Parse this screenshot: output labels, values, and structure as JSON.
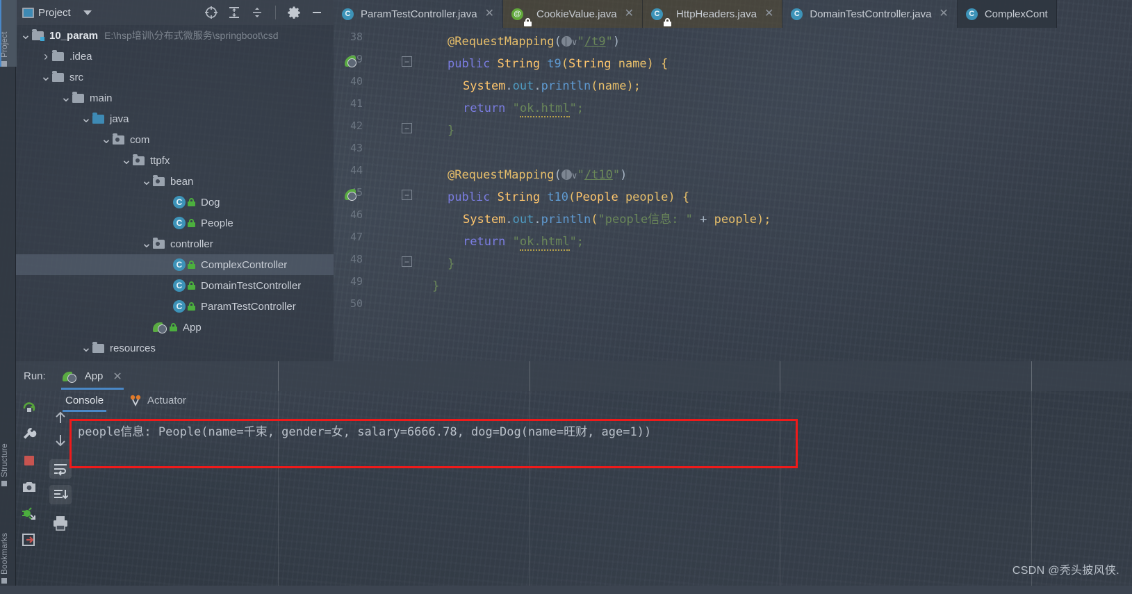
{
  "left_strip": {
    "items": [
      {
        "label": "Project",
        "icon": "project-icon",
        "selected": true
      },
      {
        "label": "Structure",
        "icon": "structure-icon",
        "selected": false
      },
      {
        "label": "Bookmarks",
        "icon": "bookmarks-icon",
        "selected": false
      }
    ]
  },
  "project_panel": {
    "title": "Project",
    "icon": "project-window-icon",
    "dropdown_icon": "chevron-down-icon",
    "toolbar": [
      {
        "name": "locate-icon",
        "tooltip": "Select Opened File"
      },
      {
        "name": "expand-all-icon",
        "tooltip": "Expand All"
      },
      {
        "name": "collapse-all-icon",
        "tooltip": "Collapse All"
      },
      {
        "name": "gear-icon",
        "tooltip": "Settings"
      },
      {
        "name": "minimize-icon",
        "tooltip": "Hide"
      }
    ],
    "tree": [
      {
        "label": "10_param",
        "path": "E:\\hsp培训\\分布式微服务\\springboot\\csd",
        "indent": 0,
        "arrow": "expanded",
        "icon": "module-folder",
        "bold": true,
        "selected": false
      },
      {
        "label": ".idea",
        "path": "",
        "indent": 1,
        "arrow": "collapsed",
        "icon": "folder",
        "bold": false,
        "selected": false
      },
      {
        "label": "src",
        "path": "",
        "indent": 1,
        "arrow": "expanded",
        "icon": "folder",
        "bold": false,
        "selected": false
      },
      {
        "label": "main",
        "path": "",
        "indent": 2,
        "arrow": "expanded",
        "icon": "folder",
        "bold": false,
        "selected": false
      },
      {
        "label": "java",
        "path": "",
        "indent": 3,
        "arrow": "expanded",
        "icon": "source-folder",
        "bold": false,
        "selected": false
      },
      {
        "label": "com",
        "path": "",
        "indent": 4,
        "arrow": "expanded",
        "icon": "package",
        "bold": false,
        "selected": false
      },
      {
        "label": "ttpfx",
        "path": "",
        "indent": 5,
        "arrow": "expanded",
        "icon": "package",
        "bold": false,
        "selected": false
      },
      {
        "label": "bean",
        "path": "",
        "indent": 6,
        "arrow": "expanded",
        "icon": "package",
        "bold": false,
        "selected": false
      },
      {
        "label": "Dog",
        "path": "",
        "indent": 7,
        "arrow": "none",
        "icon": "java-class",
        "bold": false,
        "selected": false
      },
      {
        "label": "People",
        "path": "",
        "indent": 7,
        "arrow": "none",
        "icon": "java-class",
        "bold": false,
        "selected": false
      },
      {
        "label": "controller",
        "path": "",
        "indent": 6,
        "arrow": "expanded",
        "icon": "package",
        "bold": false,
        "selected": false
      },
      {
        "label": "ComplexController",
        "path": "",
        "indent": 7,
        "arrow": "none",
        "icon": "java-class",
        "bold": false,
        "selected": true
      },
      {
        "label": "DomainTestController",
        "path": "",
        "indent": 7,
        "arrow": "none",
        "icon": "java-class",
        "bold": false,
        "selected": false
      },
      {
        "label": "ParamTestController",
        "path": "",
        "indent": 7,
        "arrow": "none",
        "icon": "java-class",
        "bold": false,
        "selected": false
      },
      {
        "label": "App",
        "path": "",
        "indent": 6,
        "arrow": "none",
        "icon": "spring-runnable-class",
        "bold": false,
        "selected": false
      },
      {
        "label": "resources",
        "path": "",
        "indent": 3,
        "arrow": "expanded",
        "icon": "folder",
        "bold": false,
        "selected": false
      }
    ]
  },
  "editor_tabs": [
    {
      "label": "ParamTestController.java",
      "icon": "java-class",
      "active": false,
      "closable": true,
      "style": "normal"
    },
    {
      "label": "CookieValue.java",
      "icon": "java-annotation",
      "active": false,
      "closable": true,
      "style": "library"
    },
    {
      "label": "HttpHeaders.java",
      "icon": "java-class",
      "active": false,
      "closable": true,
      "style": "library"
    },
    {
      "label": "DomainTestController.java",
      "icon": "java-class",
      "active": false,
      "closable": true,
      "style": "normal"
    },
    {
      "label": "ComplexCont",
      "icon": "java-class",
      "active": true,
      "closable": false,
      "style": "normal"
    }
  ],
  "editor": {
    "first_line": 38,
    "lines": [
      {
        "num": 38,
        "indent": 2,
        "gutter": "",
        "fold": "",
        "tokens": [
          {
            "t": "@RequestMapping",
            "c": "y"
          },
          {
            "t": "(",
            "c": "t"
          },
          {
            "t": "GLOBE",
            "c": "icon"
          },
          {
            "t": "\"",
            "c": "s"
          },
          {
            "t": "/t9",
            "c": "s u"
          },
          {
            "t": "\"",
            "c": "s"
          },
          {
            "t": ")",
            "c": "t"
          }
        ]
      },
      {
        "num": 39,
        "indent": 2,
        "gutter": "spring-bean",
        "fold": "minus",
        "tokens": [
          {
            "t": "public ",
            "c": "kw"
          },
          {
            "t": "String ",
            "c": "m"
          },
          {
            "t": "t9",
            "c": "bl"
          },
          {
            "t": "(",
            "c": "y"
          },
          {
            "t": "String ",
            "c": "m"
          },
          {
            "t": "name",
            "c": "y"
          },
          {
            "t": ") {",
            "c": "y"
          }
        ]
      },
      {
        "num": 40,
        "indent": 3,
        "gutter": "",
        "fold": "",
        "tokens": [
          {
            "t": "System",
            "c": "m"
          },
          {
            "t": ".",
            "c": "t"
          },
          {
            "t": "out",
            "c": "cy"
          },
          {
            "t": ".",
            "c": "t"
          },
          {
            "t": "println",
            "c": "bl"
          },
          {
            "t": "(",
            "c": "y"
          },
          {
            "t": "name",
            "c": "y"
          },
          {
            "t": ");",
            "c": "y"
          }
        ]
      },
      {
        "num": 41,
        "indent": 3,
        "gutter": "",
        "fold": "",
        "tokens": [
          {
            "t": "return ",
            "c": "kw"
          },
          {
            "t": "\"",
            "c": "s"
          },
          {
            "t": "ok.html",
            "c": "s wavy"
          },
          {
            "t": "\";",
            "c": "s"
          }
        ]
      },
      {
        "num": 42,
        "indent": 2,
        "gutter": "",
        "fold": "minus",
        "tokens": [
          {
            "t": "}",
            "c": "s"
          }
        ]
      },
      {
        "num": 43,
        "indent": 0,
        "gutter": "",
        "fold": "",
        "tokens": []
      },
      {
        "num": 44,
        "indent": 2,
        "gutter": "",
        "fold": "",
        "tokens": [
          {
            "t": "@RequestMapping",
            "c": "y"
          },
          {
            "t": "(",
            "c": "t"
          },
          {
            "t": "GLOBE",
            "c": "icon"
          },
          {
            "t": "\"",
            "c": "s"
          },
          {
            "t": "/t10",
            "c": "s u"
          },
          {
            "t": "\"",
            "c": "s"
          },
          {
            "t": ")",
            "c": "t"
          }
        ]
      },
      {
        "num": 45,
        "indent": 2,
        "gutter": "spring-bean",
        "fold": "minus",
        "tokens": [
          {
            "t": "public ",
            "c": "kw"
          },
          {
            "t": "String ",
            "c": "m"
          },
          {
            "t": "t10",
            "c": "bl"
          },
          {
            "t": "(",
            "c": "y"
          },
          {
            "t": "People ",
            "c": "m"
          },
          {
            "t": "people",
            "c": "y"
          },
          {
            "t": ") {",
            "c": "y"
          }
        ]
      },
      {
        "num": 46,
        "indent": 3,
        "gutter": "",
        "fold": "",
        "tokens": [
          {
            "t": "System",
            "c": "m"
          },
          {
            "t": ".",
            "c": "t"
          },
          {
            "t": "out",
            "c": "cy"
          },
          {
            "t": ".",
            "c": "t"
          },
          {
            "t": "println",
            "c": "bl"
          },
          {
            "t": "(",
            "c": "y"
          },
          {
            "t": "\"people信息: \"",
            "c": "s"
          },
          {
            "t": " + ",
            "c": "t"
          },
          {
            "t": "people",
            "c": "y"
          },
          {
            "t": ");",
            "c": "y"
          }
        ]
      },
      {
        "num": 47,
        "indent": 3,
        "gutter": "",
        "fold": "",
        "tokens": [
          {
            "t": "return ",
            "c": "kw"
          },
          {
            "t": "\"",
            "c": "s"
          },
          {
            "t": "ok.html",
            "c": "s wavy"
          },
          {
            "t": "\";",
            "c": "s"
          }
        ]
      },
      {
        "num": 48,
        "indent": 2,
        "gutter": "",
        "fold": "minus",
        "tokens": [
          {
            "t": "}",
            "c": "s"
          }
        ]
      },
      {
        "num": 49,
        "indent": 1,
        "gutter": "",
        "fold": "",
        "tokens": [
          {
            "t": "}",
            "c": "s"
          }
        ]
      },
      {
        "num": 50,
        "indent": 0,
        "gutter": "",
        "fold": "",
        "tokens": []
      }
    ]
  },
  "run_window": {
    "label": "Run:",
    "config_name": "App",
    "config_icon": "spring-boot-icon",
    "close_icon": "close-icon",
    "tabs": [
      {
        "label": "Console",
        "icon": "console-icon",
        "active": true
      },
      {
        "label": "Actuator",
        "icon": "actuator-icon",
        "active": false
      }
    ],
    "left_tools": [
      {
        "name": "rerun-icon",
        "color": "#57a53b"
      },
      {
        "name": "edit-configurations-icon",
        "color": "#b9bfc7"
      },
      {
        "name": "stop-icon",
        "color": "#c75450"
      },
      {
        "name": "screenshot-icon",
        "color": "#b9bfc7"
      },
      {
        "name": "debug-attach-icon",
        "color": "#4caf3e"
      },
      {
        "name": "exit-icon",
        "color": "#c75450"
      }
    ],
    "console_tools": [
      {
        "name": "up-arrow-icon"
      },
      {
        "name": "down-arrow-icon"
      },
      {
        "name": "soft-wrap-icon"
      },
      {
        "name": "scroll-to-end-icon"
      },
      {
        "name": "print-icon"
      }
    ],
    "output": "people信息: People(name=千束, gender=女, salary=6666.78, dog=Dog(name=旺财, age=1))",
    "highlight_color": "#f01a1a"
  },
  "watermark": "CSDN @秃头披风侠."
}
